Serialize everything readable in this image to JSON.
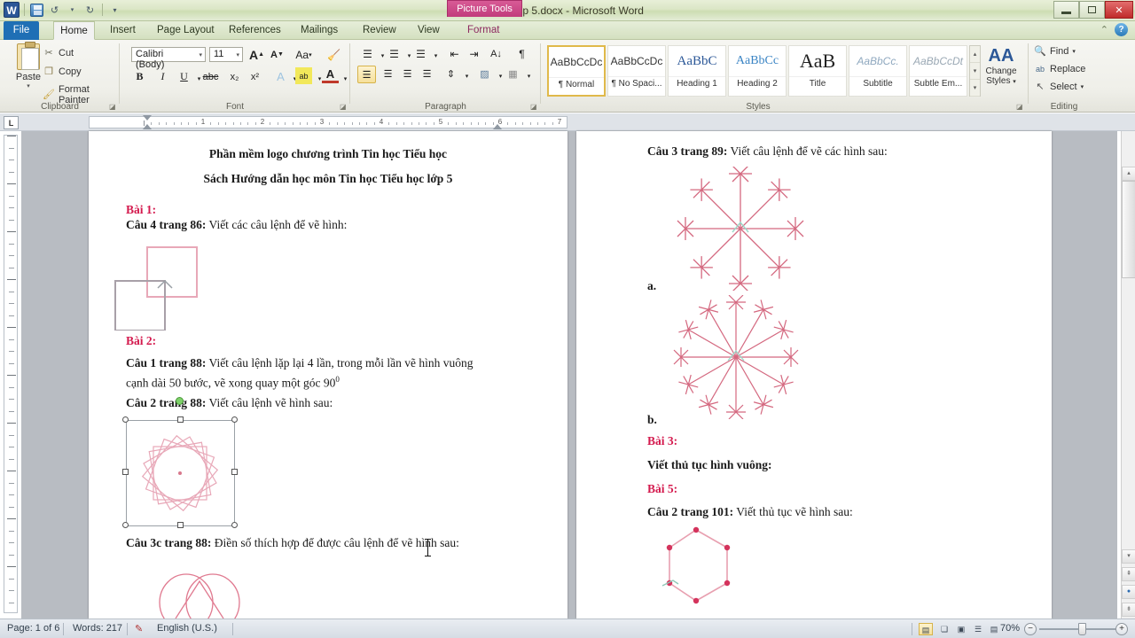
{
  "window": {
    "title": "logo lop 5.docx  -  Microsoft Word",
    "contextual_tab": "Picture Tools",
    "minimize": "—",
    "restore": "❐",
    "close": "✕",
    "help_icon": "help-icon",
    "collapse_icon": "collapse-ribbon-icon"
  },
  "quick_access": {
    "word_logo": "W",
    "save": "save-icon",
    "undo": "↺",
    "redo": "↻",
    "customize": "▾"
  },
  "tabs": [
    {
      "label": "File",
      "id": "file"
    },
    {
      "label": "Home",
      "id": "home"
    },
    {
      "label": "Insert",
      "id": "insert"
    },
    {
      "label": "Page Layout",
      "id": "page-layout"
    },
    {
      "label": "References",
      "id": "references"
    },
    {
      "label": "Mailings",
      "id": "mailings"
    },
    {
      "label": "Review",
      "id": "review"
    },
    {
      "label": "View",
      "id": "view"
    },
    {
      "label": "Format",
      "id": "format"
    }
  ],
  "active_tab": "Home",
  "ribbon": {
    "clipboard": {
      "label": "Clipboard",
      "paste": "Paste",
      "items": [
        {
          "label": "Cut",
          "icon": "scissors-icon"
        },
        {
          "label": "Copy",
          "icon": "copy-icon"
        },
        {
          "label": "Format Painter",
          "icon": "paintbrush-icon"
        }
      ]
    },
    "font": {
      "label": "Font",
      "font_name": "Calibri (Body)",
      "font_size": "11",
      "grow": "A",
      "shrink": "A",
      "change_case": "Aa",
      "clear_formatting": "clear-formatting-icon",
      "bold": "B",
      "italic": "I",
      "underline": "U",
      "strikethrough": "abc",
      "subscript": "x₂",
      "superscript": "x²",
      "text_effects": "A",
      "highlight": "ab",
      "font_color": "A"
    },
    "paragraph": {
      "label": "Paragraph",
      "bullets": "bullets-icon",
      "numbering": "numbering-icon",
      "multilevel": "multilevel-list-icon",
      "decrease_indent": "decrease-indent-icon",
      "increase_indent": "increase-indent-icon",
      "sort": "sort-icon",
      "show_marks": "¶",
      "align_left": "align-left-icon",
      "align_center": "align-center-icon",
      "align_right": "align-right-icon",
      "justify": "justify-icon",
      "line_spacing": "line-spacing-icon",
      "shading": "shading-icon",
      "borders": "borders-icon"
    },
    "styles": {
      "label": "Styles",
      "items": [
        {
          "preview": "AaBbCcDc",
          "name": "¶ Normal",
          "selected": true
        },
        {
          "preview": "AaBbCcDc",
          "name": "¶ No Spaci...",
          "selected": false
        },
        {
          "preview": "AaBbC",
          "name": "Heading 1",
          "selected": false
        },
        {
          "preview": "AaBbCc",
          "name": "Heading 2",
          "selected": false
        },
        {
          "preview": "AaB",
          "name": "Title",
          "selected": false
        },
        {
          "preview": "AaBbCc.",
          "name": "Subtitle",
          "selected": false
        },
        {
          "preview": "AaBbCcDt",
          "name": "Subtle Em...",
          "selected": false
        }
      ],
      "change_styles_line1": "Change",
      "change_styles_line2": "Styles"
    },
    "editing": {
      "label": "Editing",
      "find": "Find",
      "replace": "Replace",
      "select": "Select"
    }
  },
  "ruler": {
    "corner_tab": "L",
    "numbers": [
      "1",
      "2",
      "3",
      "4",
      "5",
      "6",
      "7"
    ]
  },
  "document": {
    "left_page": {
      "title1": "Phần mềm logo chương trình Tin học Tiểu học",
      "title2": "Sách Hướng dẫn học môn Tin học Tiểu học lớp 5",
      "bai1": "Bài 1:",
      "cau4": "Câu 4 trang 86:",
      "cau4_rest": " Viết các câu lệnh để vẽ hình:",
      "bai2": "Bài 2:",
      "cau1": "Câu 1 trang 88:",
      "cau1_rest": " Viết câu lệnh lặp lại 4 lần, trong mỗi lần vẽ hình vuông",
      "cau1_line2": "cạnh dài 50 bước, vẽ xong quay một góc 90",
      "cau1_sup": "0",
      "cau2": "Câu 2 trang 88:",
      "cau2_rest": " Viết câu lệnh vẽ hình sau:",
      "cau3c": "Câu 3c trang 88:",
      "cau3c_rest": " Điền số thích hợp để được câu lệnh để vẽ hình sau:"
    },
    "right_page": {
      "cau3": "Câu 3 trang 89:",
      "cau3_rest": " Viết câu lệnh để vẽ các hình sau:",
      "label_a": "a.",
      "label_b": "b.",
      "bai3": "Bài 3:",
      "bai3_text": "Viết thủ tục hình vuông:",
      "bai5": "Bài 5:",
      "cau2_101": "Câu 2 trang 101:",
      "cau2_101_rest": " Viết thủ tục vẽ hình sau:"
    },
    "figures": {
      "two_squares": "two-squares-figure",
      "pinwheel": "pinwheel-figure-selected",
      "circles": "three-circles-figure",
      "snowflake_a": "snowflake-8-spoke-figure",
      "snowflake_b": "snowflake-12-spoke-figure",
      "hexagon": "hexagon-figure"
    },
    "shape_color": "#e8889c"
  },
  "status_bar": {
    "page": "Page: 1 of 6",
    "words": "Words: 217",
    "proofing_icon": "proofing-errors-icon",
    "language": "English (U.S.)",
    "zoom": "70%",
    "zoom_out": "−",
    "zoom_in": "+",
    "views": [
      {
        "icon": "print-layout-icon",
        "selected": true
      },
      {
        "icon": "full-screen-reading-icon",
        "selected": false
      },
      {
        "icon": "web-layout-icon",
        "selected": false
      },
      {
        "icon": "outline-icon",
        "selected": false
      },
      {
        "icon": "draft-icon",
        "selected": false
      }
    ]
  }
}
